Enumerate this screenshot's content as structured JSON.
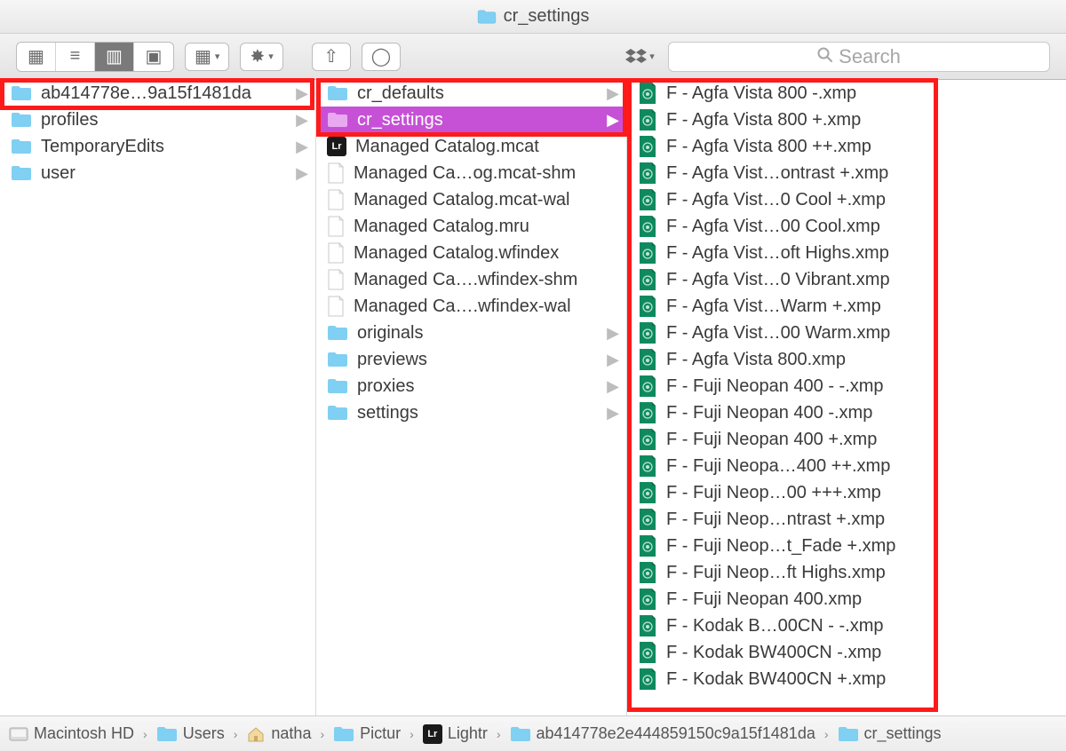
{
  "window": {
    "title": "cr_settings"
  },
  "search": {
    "placeholder": "Search"
  },
  "col1": [
    {
      "type": "folder",
      "label": "ab414778e…9a15f1481da",
      "chev": true
    },
    {
      "type": "folder",
      "label": "profiles",
      "chev": true
    },
    {
      "type": "folder",
      "label": "TemporaryEdits",
      "chev": true
    },
    {
      "type": "folder",
      "label": "user",
      "chev": true
    }
  ],
  "col2": [
    {
      "type": "folder",
      "label": "cr_defaults",
      "chev": true
    },
    {
      "type": "folder",
      "label": "cr_settings",
      "chev": true,
      "selected": true
    },
    {
      "type": "lr",
      "label": "Managed Catalog.mcat"
    },
    {
      "type": "file",
      "label": "Managed Ca…og.mcat-shm"
    },
    {
      "type": "file",
      "label": "Managed Catalog.mcat-wal"
    },
    {
      "type": "file",
      "label": "Managed Catalog.mru"
    },
    {
      "type": "file",
      "label": "Managed Catalog.wfindex"
    },
    {
      "type": "file",
      "label": "Managed Ca….wfindex-shm"
    },
    {
      "type": "file",
      "label": "Managed Ca….wfindex-wal"
    },
    {
      "type": "folder",
      "label": "originals",
      "chev": true
    },
    {
      "type": "folder",
      "label": "previews",
      "chev": true
    },
    {
      "type": "folder",
      "label": "proxies",
      "chev": true
    },
    {
      "type": "folder",
      "label": "settings",
      "chev": true
    }
  ],
  "col3": [
    {
      "label": "F - Agfa Vista 800 -.xmp"
    },
    {
      "label": "F - Agfa Vista 800 +.xmp"
    },
    {
      "label": "F - Agfa Vista 800 ++.xmp"
    },
    {
      "label": "F - Agfa Vist…ontrast +.xmp"
    },
    {
      "label": "F - Agfa Vist…0 Cool +.xmp"
    },
    {
      "label": "F - Agfa Vist…00 Cool.xmp"
    },
    {
      "label": "F - Agfa Vist…oft Highs.xmp"
    },
    {
      "label": "F - Agfa Vist…0 Vibrant.xmp"
    },
    {
      "label": "F - Agfa Vist…Warm +.xmp"
    },
    {
      "label": "F - Agfa Vist…00 Warm.xmp"
    },
    {
      "label": "F - Agfa Vista 800.xmp"
    },
    {
      "label": "F - Fuji Neopan 400 - -.xmp"
    },
    {
      "label": "F - Fuji Neopan 400 -.xmp"
    },
    {
      "label": "F - Fuji Neopan 400 +.xmp"
    },
    {
      "label": "F - Fuji Neopa…400 ++.xmp"
    },
    {
      "label": "F - Fuji Neop…00 +++.xmp"
    },
    {
      "label": "F - Fuji Neop…ntrast +.xmp"
    },
    {
      "label": "F - Fuji Neop…t_Fade +.xmp"
    },
    {
      "label": "F - Fuji Neop…ft Highs.xmp"
    },
    {
      "label": "F - Fuji Neopan 400.xmp"
    },
    {
      "label": "F - Kodak B…00CN - -.xmp"
    },
    {
      "label": "F - Kodak BW400CN -.xmp"
    },
    {
      "label": "F - Kodak BW400CN +.xmp"
    }
  ],
  "pathbar": [
    {
      "icon": "disk",
      "label": "Macintosh HD"
    },
    {
      "icon": "folder",
      "label": "Users"
    },
    {
      "icon": "home",
      "label": "natha"
    },
    {
      "icon": "folder",
      "label": "Pictur"
    },
    {
      "icon": "lr",
      "label": "Lightr"
    },
    {
      "icon": "folder",
      "label": "ab414778e2e444859150c9a15f1481da"
    },
    {
      "icon": "folder",
      "label": "cr_settings"
    }
  ]
}
